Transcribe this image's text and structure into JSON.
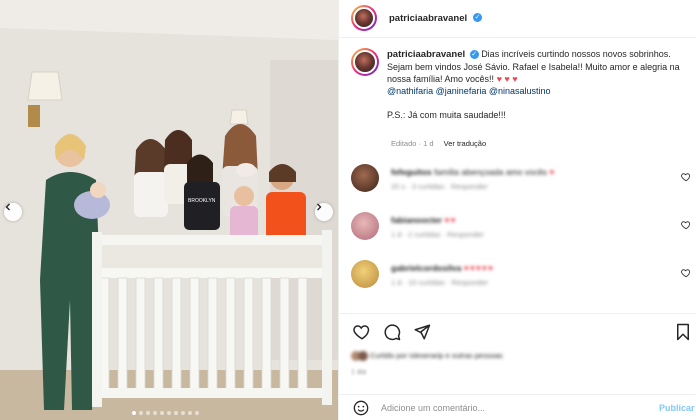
{
  "post": {
    "author": "patriciaabravanel",
    "verified": true
  },
  "caption": {
    "author": "patriciaabravanel",
    "text": "Dias incríveis curtindo nossos novos sobrinhos. Sejam bem vindos José Sávio. Rafael e Isabela!! Muito amor e alegria na nossa família! Amo vocês!!",
    "hearts": "♥ ♥ ♥",
    "mentions": "@nathifaria @janinefaria @ninasalustino",
    "ps": "P.S.: Já com muita saudade!!!",
    "edited": "Editado · 1 d",
    "see_translation": "Ver tradução"
  },
  "comments": [
    {
      "user": "fefeguitos",
      "text": "família abençoada amo vocês",
      "hearts": "♥",
      "meta": "20 s · 3 curtidas · Responder"
    },
    {
      "user": "fabianoocter",
      "text": "",
      "hearts": "♥♥",
      "meta": "1 d · 2 curtidas · Responder"
    },
    {
      "user": "gabrielcordosilva",
      "text": "",
      "hearts": "♥♥♥♥♥",
      "meta": "1 d · 10 curtidas · Responder"
    }
  ],
  "likes_line": "Curtido por isleserarip e outras pessoas",
  "date": "1 dia",
  "add_comment": {
    "placeholder": "Adicione um comentário...",
    "publish_label": "Publicar"
  },
  "carousel": {
    "count": 10,
    "active_index": 0
  },
  "colors": {
    "accent": "#0095f6",
    "heart": "#ed4956",
    "verified": "#3897f0",
    "mention": "#00376b"
  }
}
